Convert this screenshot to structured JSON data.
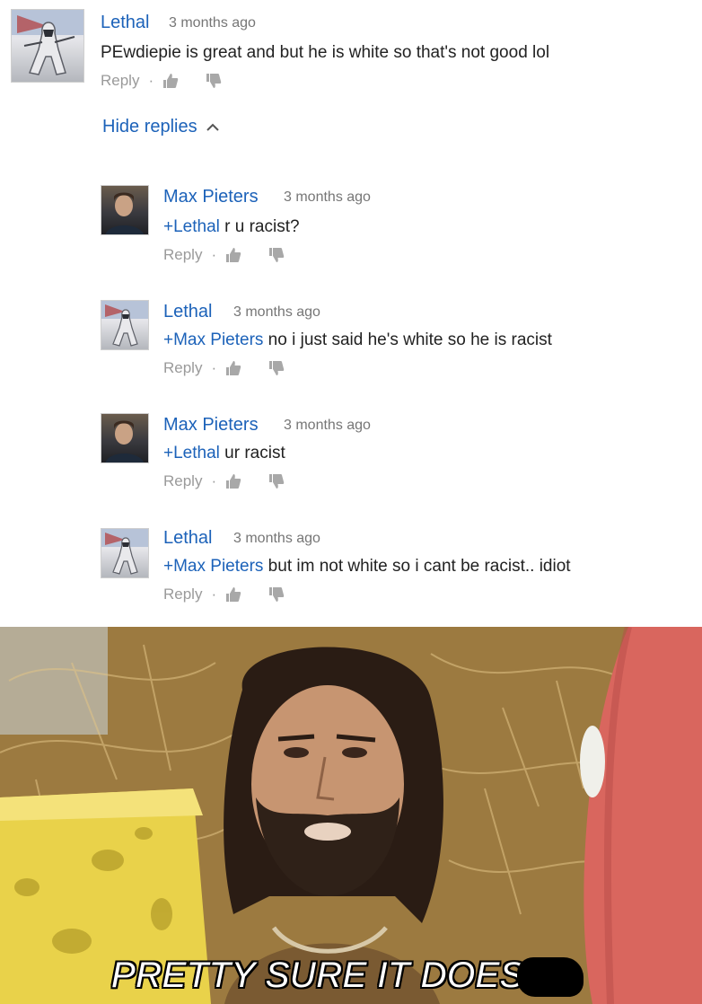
{
  "comments": [
    {
      "author": "Lethal",
      "time": "3 months ago",
      "text": "PEwdiepie is great and but he is white so that's not good lol",
      "mention": "",
      "reply_label": "Reply",
      "separator": "·"
    },
    {
      "author": "Max Pieters",
      "time": "3 months ago",
      "mention": "+Lethal",
      "text": " r u racist?",
      "reply_label": "Reply",
      "separator": "·"
    },
    {
      "author": "Lethal",
      "time": "3 months ago",
      "mention": "+Max Pieters",
      "text": " no i just said he's white so he is racist",
      "reply_label": "Reply",
      "separator": "·"
    },
    {
      "author": "Max Pieters",
      "time": "3 months ago",
      "mention": "+Lethal",
      "text": " ur racist",
      "reply_label": "Reply",
      "separator": "·"
    },
    {
      "author": "Lethal",
      "time": "3 months ago",
      "mention": "+Max Pieters",
      "text": " but im not white so i cant be racist.. idiot",
      "reply_label": "Reply",
      "separator": "·"
    }
  ],
  "hide_replies": {
    "label": "Hide replies",
    "icon": "chevron-up-icon"
  },
  "meme": {
    "caption": "PRETTY SURE IT DOES"
  },
  "colors": {
    "author": "#1c62b9",
    "text": "#222222",
    "muted": "#9a9a9a"
  }
}
